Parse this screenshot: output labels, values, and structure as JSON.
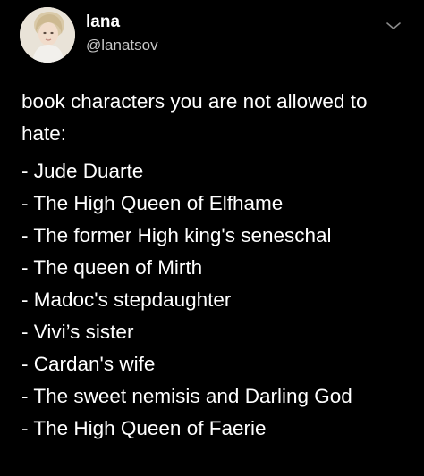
{
  "author": {
    "display_name": "lana",
    "handle": "@lanatsov",
    "avatar_icon": "profile-photo"
  },
  "menu_icon": "chevron-down-icon",
  "tweet": {
    "intro": "book characters you are not allowed to hate:",
    "items": [
      "- Jude Duarte",
      "- The High Queen of Elfhame",
      "- The former High king's seneschal",
      "- The queen of Mirth",
      "- Madoc's stepdaughter",
      "- Vivi’s sister",
      "- Cardan's wife",
      "- The sweet nemisis and Darling God",
      "- The High Queen of Faerie"
    ]
  },
  "colors": {
    "background": "#000000",
    "text": "#ffffff",
    "secondary_text": "#c7c7c7"
  }
}
